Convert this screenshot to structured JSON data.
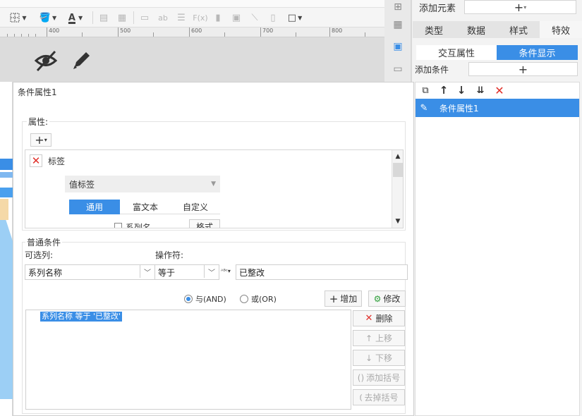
{
  "toolbar": {
    "ruler_marks": [
      "400",
      "500",
      "600",
      "700",
      "800"
    ]
  },
  "right_panel": {
    "add_element_label": "添加元素",
    "tabs": [
      "类型",
      "数据",
      "样式",
      "特效"
    ],
    "active_tab": "特效",
    "subtabs": [
      "交互属性",
      "条件显示"
    ],
    "add_condition_label": "添加条件",
    "condition_items": [
      "条件属性1"
    ]
  },
  "dialog": {
    "title": "条件属性1",
    "attributes_legend": "属性:",
    "attr_item": {
      "label": "标签",
      "select_value": "值标签",
      "label_tabs": [
        "通用",
        "富文本",
        "自定义"
      ],
      "checkbox_label": "系列名",
      "format_button": "格式"
    },
    "common_condition_legend": "普通条件",
    "optional_column_label": "可选列:",
    "operator_label": "操作符:",
    "column_value": "系列名称",
    "operator_value": "等于",
    "value_input": "已整改",
    "and_label": "与(AND)",
    "or_label": "或(OR)",
    "add_button": "增加",
    "modify_button": "修改",
    "condition_text": "系列名称 等于 '已整改'",
    "delete_button": "删除",
    "move_up_button": "上移",
    "move_down_button": "下移",
    "add_bracket_button": "添加括号",
    "remove_bracket_button": "去掉括号"
  },
  "colors": {
    "accent": "#3a8ee6",
    "delete_red": "#e0302a"
  }
}
